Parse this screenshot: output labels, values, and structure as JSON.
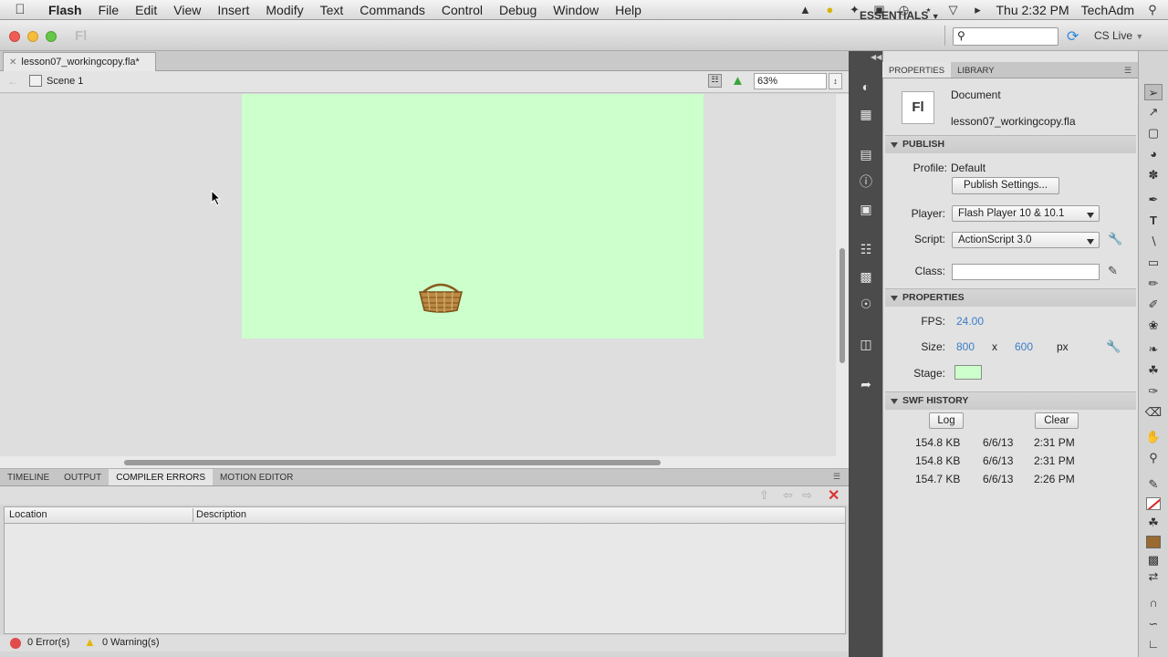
{
  "menubar": {
    "items": [
      "Flash",
      "File",
      "Edit",
      "View",
      "Insert",
      "Modify",
      "Text",
      "Commands",
      "Control",
      "Debug",
      "Window",
      "Help"
    ],
    "clock": "Thu 2:32 PM",
    "user": "TechAdm"
  },
  "appbar": {
    "logo": "Fl",
    "workspace": "ESSENTIALS",
    "cs_live": "CS Live",
    "search_value": ""
  },
  "document": {
    "tab_label": "lesson07_workingcopy.fla*",
    "scene": "Scene 1",
    "zoom": "63%"
  },
  "stage": {
    "color": "#ccffcc"
  },
  "bottom_panel": {
    "tabs": [
      "TIMELINE",
      "OUTPUT",
      "COMPILER ERRORS",
      "MOTION EDITOR"
    ],
    "active_tab": "COMPILER ERRORS",
    "columns": [
      "Location",
      "Description"
    ],
    "errors": "0 Error(s)",
    "warnings": "0 Warning(s)"
  },
  "properties": {
    "tabs": [
      "PROPERTIES",
      "LIBRARY"
    ],
    "doc_icon": "Fl",
    "doc_type": "Document",
    "doc_name": "lesson07_workingcopy.fla",
    "publish": {
      "header": "PUBLISH",
      "profile_label": "Profile:",
      "profile_value": "Default",
      "settings_button": "Publish Settings...",
      "player_label": "Player:",
      "player_value": "Flash Player 10 & 10.1",
      "script_label": "Script:",
      "script_value": "ActionScript 3.0",
      "class_label": "Class:",
      "class_value": ""
    },
    "props": {
      "header": "PROPERTIES",
      "fps_label": "FPS:",
      "fps_value": "24.00",
      "size_label": "Size:",
      "width": "800",
      "x": "x",
      "height": "600",
      "unit": "px",
      "stage_label": "Stage:",
      "stage_color": "#ccffcc"
    },
    "swf_history": {
      "header": "SWF HISTORY",
      "log_button": "Log",
      "clear_button": "Clear",
      "rows": [
        {
          "size": "154.8 KB",
          "date": "6/6/13",
          "time": "2:31 PM"
        },
        {
          "size": "154.8 KB",
          "date": "6/6/13",
          "time": "2:31 PM"
        },
        {
          "size": "154.7 KB",
          "date": "6/6/13",
          "time": "2:26 PM"
        }
      ]
    }
  }
}
